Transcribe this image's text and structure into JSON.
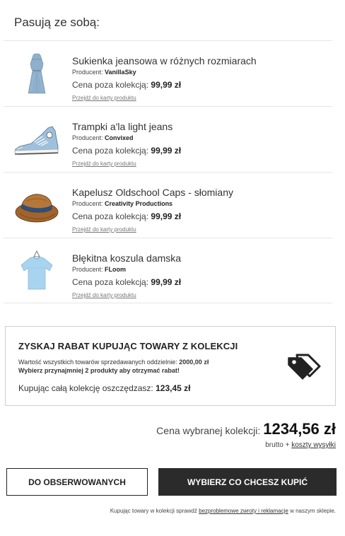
{
  "heading": "Pasują ze sobą:",
  "products": [
    {
      "name": "Sukienka jeansowa w różnych rozmiarach",
      "producer_label": "Producent:",
      "producer": "VanillaSky",
      "price_label": "Cena poza kolekcją:",
      "price": "99,99 zł",
      "link": "Przejdź do karty produktu",
      "icon": "dress-image"
    },
    {
      "name": "Trampki a'la light jeans",
      "producer_label": "Producent:",
      "producer": "Convixed",
      "price_label": "Cena poza kolekcją:",
      "price": "99,99 zł",
      "link": "Przejdź do karty produktu",
      "icon": "sneaker-image"
    },
    {
      "name": "Kapelusz Oldschool Caps - słomiany",
      "producer_label": "Producent:",
      "producer": "Creativity Productions",
      "price_label": "Cena poza kolekcją:",
      "price": "99,99 zł",
      "link": "Przejdź do karty produktu",
      "icon": "hat-image"
    },
    {
      "name": "Błękitna koszula damska",
      "producer_label": "Producent:",
      "producer": "FLoom",
      "price_label": "Cena poza kolekcją:",
      "price": "99,99 zł",
      "link": "Przejdź do karty produktu",
      "icon": "shirt-image"
    }
  ],
  "discount": {
    "title": "ZYSKAJ RABAT KUPUJĄC TOWARY Z KOLEKCJI",
    "total_label": "Wartość wszystkich towarów sprzedawanych oddzielnie:",
    "total_value": "2000,00 zł",
    "hint": "Wybierz przynajmniej 2 produkty aby otrzymać rabat!",
    "save_label": "Kupując całą kolekcję oszczędzasz:",
    "save_value": "123,45 zł",
    "icon": "price-tags-icon"
  },
  "summary": {
    "label": "Cena wybranej kolekcji:",
    "value": "1234,56 zł",
    "brutto": "brutto +",
    "shipping_link": "koszty wysyłki"
  },
  "buttons": {
    "watch": "DO OBSERWOWANYCH",
    "buy": "WYBIERZ CO CHCESZ KUPIĆ"
  },
  "footer": {
    "before": "Kupując towary w kolekcji sprawdź",
    "link": "bezproblemowe zwroty i reklamacje",
    "after": "w naszym sklepie."
  },
  "colors": {
    "button_dark": "#2b2b2b",
    "denim": "#8fb0cc",
    "shirt": "#a9d4f0",
    "straw": "#a0642d"
  }
}
